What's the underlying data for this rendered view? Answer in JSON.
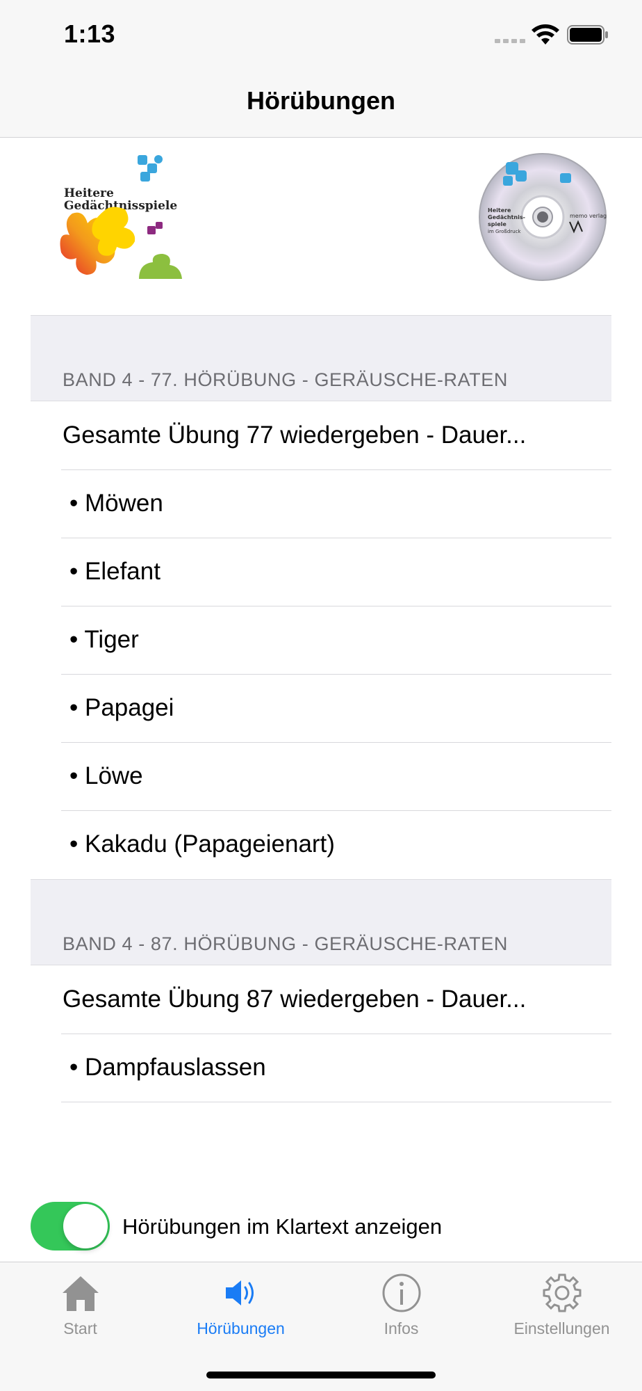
{
  "status_bar": {
    "time": "1:13"
  },
  "nav": {
    "title": "Hörübungen"
  },
  "header_images": {
    "logo_text_line1": "Heitere",
    "logo_text_line2": "Gedächtnisspiele",
    "cd_text_line1": "Heitere",
    "cd_text_line2": "Gedächtnis-",
    "cd_text_line3": "spiele",
    "cd_text_line4": "im Großdruck",
    "cd_brand": "memo verlag"
  },
  "sections": [
    {
      "header": "BAND 4 - 77. HÖRÜBUNG - GERÄUSCHE-RATEN",
      "rows": [
        "Gesamte Übung 77 wiedergeben - Dauer...",
        "• Möwen",
        "• Elefant",
        "• Tiger",
        "• Papagei",
        "• Löwe",
        "• Kakadu (Papageienart)"
      ]
    },
    {
      "header": "BAND 4 - 87. HÖRÜBUNG - GERÄUSCHE-RATEN",
      "rows": [
        "Gesamte Übung 87 wiedergeben - Dauer...",
        "• Dampfauslassen"
      ]
    }
  ],
  "toggle": {
    "label": "Hörübungen im Klartext anzeigen",
    "on": true
  },
  "tabs": [
    {
      "label": "Start",
      "icon": "house-icon"
    },
    {
      "label": "Hörübungen",
      "icon": "speaker-icon",
      "active": true
    },
    {
      "label": "Infos",
      "icon": "info-icon"
    },
    {
      "label": "Einstellungen",
      "icon": "gear-icon"
    }
  ],
  "colors": {
    "accent": "#1a7cf5",
    "toggle_on": "#34c759",
    "section_bg": "#efeff4"
  }
}
